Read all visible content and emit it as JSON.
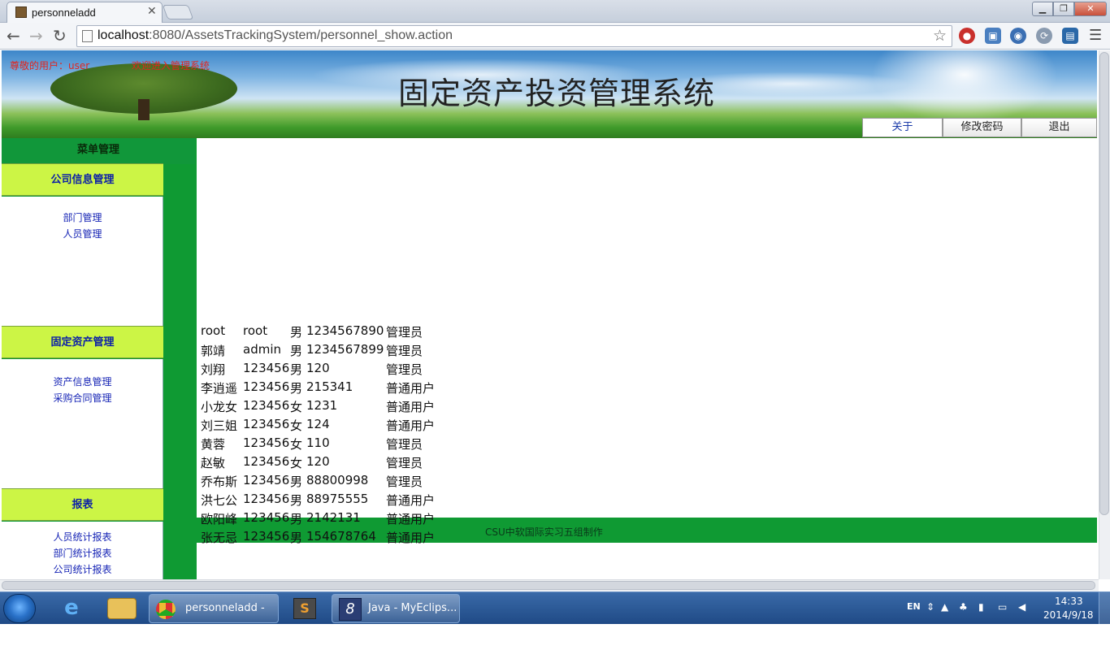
{
  "browser": {
    "tab_title": "personneladd",
    "url_host": "localhost",
    "url_rest": ":8080/AssetsTrackingSystem/personnel_show.action"
  },
  "header": {
    "user_greeting": "尊敬的用户：user",
    "welcome": "欢迎进入管理系统",
    "system_title": "固定资产投资管理系统",
    "buttons": {
      "about": "关于",
      "change_password": "修改密码",
      "logout": "退出"
    }
  },
  "sidebar": {
    "menu_title": "菜单管理",
    "sections": [
      {
        "title": "公司信息管理",
        "links": [
          "部门管理",
          "人员管理"
        ]
      },
      {
        "title": "固定资产管理",
        "links": [
          "资产信息管理",
          "采购合同管理"
        ]
      },
      {
        "title": "报表",
        "links": [
          "人员统计报表",
          "部门统计报表",
          "公司统计报表"
        ]
      }
    ]
  },
  "personnel_rows": [
    [
      "root",
      "root",
      "男",
      "1234567890",
      "管理员"
    ],
    [
      "郭靖",
      "admin",
      "男",
      "1234567899",
      "管理员"
    ],
    [
      "刘翔",
      "123456",
      "男",
      "120",
      "管理员"
    ],
    [
      "李逍遥",
      "123456",
      "男",
      "215341",
      "普通用户"
    ],
    [
      "小龙女",
      "123456",
      "女",
      "1231",
      "普通用户"
    ],
    [
      "刘三姐",
      "123456",
      "女",
      "124",
      "普通用户"
    ],
    [
      "黄蓉",
      "123456",
      "女",
      "110",
      "管理员"
    ],
    [
      "赵敏",
      "123456",
      "女",
      "120",
      "管理员"
    ],
    [
      "乔布斯",
      "123456",
      "男",
      "88800998",
      "管理员"
    ],
    [
      "洪七公",
      "123456",
      "男",
      "88975555",
      "普通用户"
    ],
    [
      "欧阳峰",
      "123456",
      "男",
      "2142131",
      "普通用户"
    ],
    [
      "张无忌",
      "123456",
      "男",
      "154678764",
      "普通用户"
    ]
  ],
  "footer": "CSU中软国际实习五组制作",
  "taskbar": {
    "chrome_task": "personneladd - ...",
    "eclipse_task": "Java - MyEclips...",
    "lang": "EN",
    "time": "14:33",
    "date": "2014/9/18"
  }
}
